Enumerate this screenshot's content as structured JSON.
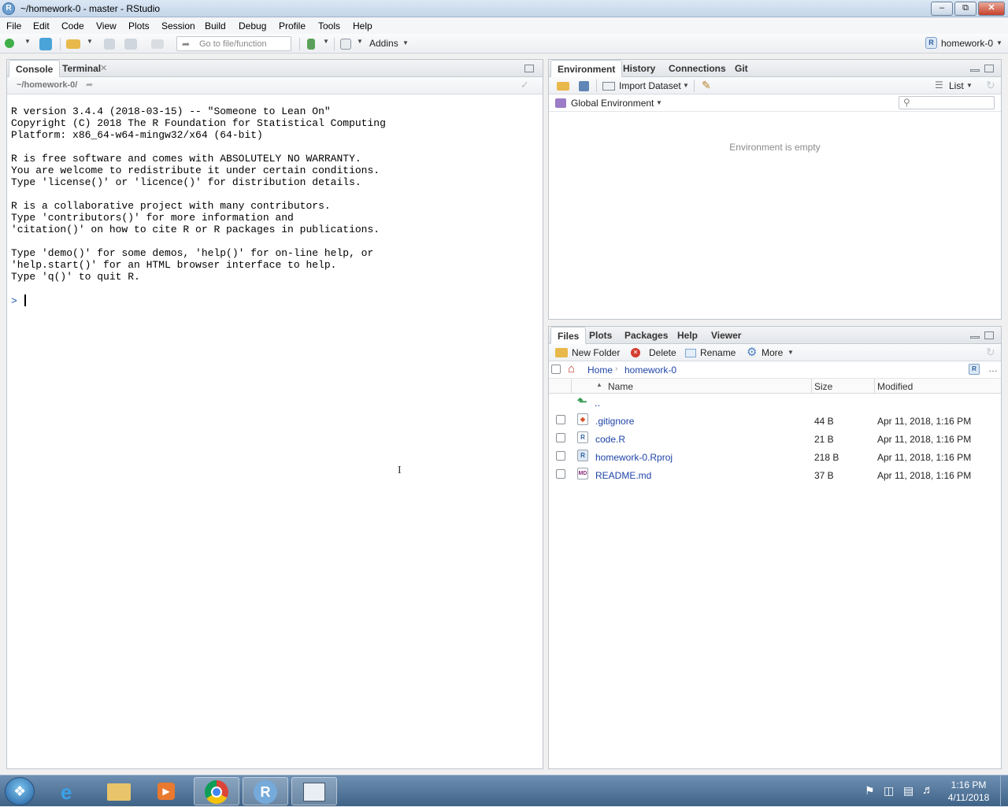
{
  "window": {
    "title": "~/homework-0 - master - RStudio"
  },
  "menu": [
    "File",
    "Edit",
    "Code",
    "View",
    "Plots",
    "Session",
    "Build",
    "Debug",
    "Profile",
    "Tools",
    "Help"
  ],
  "toolbar": {
    "goto_placeholder": "Go to file/function",
    "addins_label": "Addins",
    "project_label": "homework-0"
  },
  "console_pane": {
    "tabs": [
      "Console",
      "Terminal"
    ],
    "path": "~/homework-0/",
    "text": "R version 3.4.4 (2018-03-15) -- \"Someone to Lean On\"\nCopyright (C) 2018 The R Foundation for Statistical Computing\nPlatform: x86_64-w64-mingw32/x64 (64-bit)\n\nR is free software and comes with ABSOLUTELY NO WARRANTY.\nYou are welcome to redistribute it under certain conditions.\nType 'license()' or 'licence()' for distribution details.\n\nR is a collaborative project with many contributors.\nType 'contributors()' for more information and\n'citation()' on how to cite R or R packages in publications.\n\nType 'demo()' for some demos, 'help()' for on-line help, or\n'help.start()' for an HTML browser interface to help.\nType 'q()' to quit R.",
    "prompt": ">"
  },
  "env_pane": {
    "tabs": [
      "Environment",
      "History",
      "Connections",
      "Git"
    ],
    "import_label": "Import Dataset",
    "list_label": "List",
    "scope_label": "Global Environment",
    "empty_message": "Environment is empty"
  },
  "files_pane": {
    "tabs": [
      "Files",
      "Plots",
      "Packages",
      "Help",
      "Viewer"
    ],
    "actions": {
      "new_folder": "New Folder",
      "delete": "Delete",
      "rename": "Rename",
      "more": "More"
    },
    "breadcrumb": {
      "home": "Home",
      "current": "homework-0"
    },
    "columns": {
      "name": "Name",
      "size": "Size",
      "modified": "Modified"
    },
    "parent": "..",
    "files": [
      {
        "name": ".gitignore",
        "size": "44 B",
        "modified": "Apr 11, 2018, 1:16 PM"
      },
      {
        "name": "code.R",
        "size": "21 B",
        "modified": "Apr 11, 2018, 1:16 PM"
      },
      {
        "name": "homework-0.Rproj",
        "size": "218 B",
        "modified": "Apr 11, 2018, 1:16 PM"
      },
      {
        "name": "README.md",
        "size": "37 B",
        "modified": "Apr 11, 2018, 1:16 PM"
      }
    ]
  },
  "taskbar": {
    "time": "1:16 PM",
    "date": "4/11/2018"
  },
  "colors": {
    "link": "#1f44a6",
    "prompt": "#1a54a8",
    "taskbar": "#3f6387"
  }
}
